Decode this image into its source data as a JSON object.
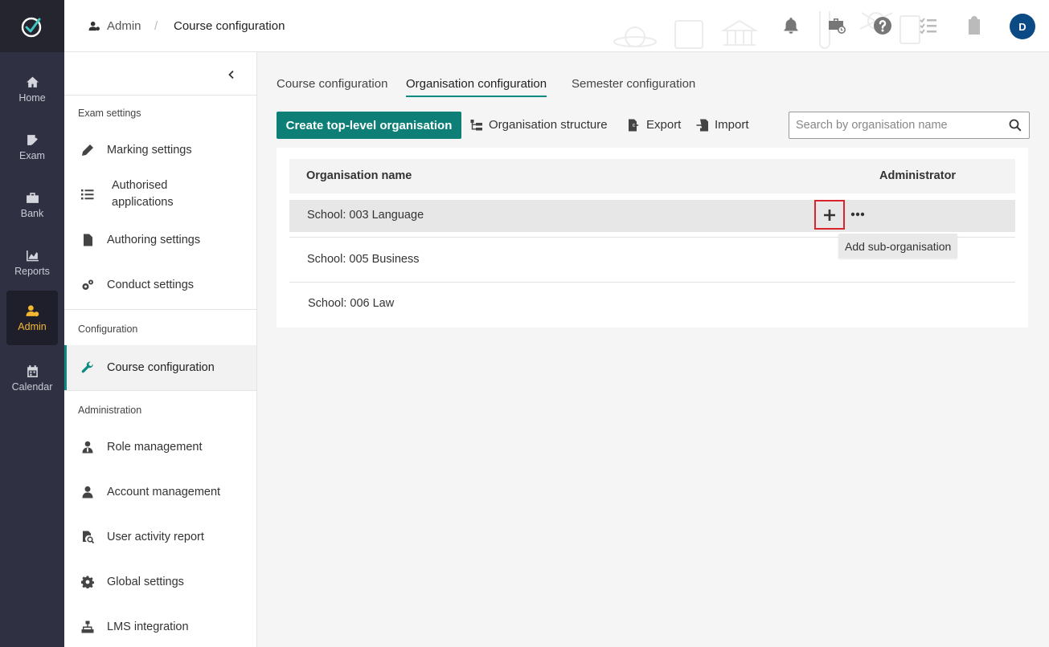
{
  "rail": {
    "items": [
      {
        "label": "Home",
        "icon": "home-icon"
      },
      {
        "label": "Exam",
        "icon": "exam-icon"
      },
      {
        "label": "Bank",
        "icon": "bank-icon"
      },
      {
        "label": "Reports",
        "icon": "reports-icon"
      },
      {
        "label": "Admin",
        "icon": "admin-icon",
        "active": true
      },
      {
        "label": "Calendar",
        "icon": "calendar-icon"
      }
    ],
    "active_color": "#f5b731"
  },
  "header": {
    "breadcrumb_root": "Admin",
    "breadcrumb_sep": "/",
    "breadcrumb_current": "Course configuration",
    "avatar_initial": "D"
  },
  "sidebar": {
    "sections": [
      {
        "label": "Exam settings"
      },
      {
        "label": "Configuration"
      },
      {
        "label": "Administration"
      }
    ],
    "items": [
      {
        "label": "Marking settings",
        "icon": "pencil-icon"
      },
      {
        "label": "Authorised applications",
        "icon": "list-icon"
      },
      {
        "label": "Authoring settings",
        "icon": "document-icon"
      },
      {
        "label": "Conduct settings",
        "icon": "gears-icon"
      },
      {
        "label": "Course configuration",
        "icon": "wrench-icon",
        "active": true
      },
      {
        "label": "Role management",
        "icon": "role-user-icon"
      },
      {
        "label": "Account management",
        "icon": "user-icon"
      },
      {
        "label": "User activity report",
        "icon": "file-search-icon"
      },
      {
        "label": "Global settings",
        "icon": "gear-icon"
      },
      {
        "label": "LMS integration",
        "icon": "sitemap-icon"
      }
    ]
  },
  "tabs": [
    {
      "label": "Course configuration"
    },
    {
      "label": "Organisation configuration",
      "active": true
    },
    {
      "label": "Semester configuration"
    }
  ],
  "toolbar": {
    "create_label": "Create top-level organisation",
    "structure_label": "Organisation structure",
    "export_label": "Export",
    "import_label": "Import",
    "search_placeholder": "Search by organisation name"
  },
  "table": {
    "columns": [
      "Organisation name",
      "Administrator"
    ],
    "rows": [
      {
        "name": "School: 003 Language"
      },
      {
        "name": "School: 005 Business"
      },
      {
        "name": "School: 006 Law"
      }
    ]
  },
  "tooltip": "Add sub-organisation",
  "colors": {
    "accent": "#0e7f77",
    "highlight_border": "#d9232d",
    "avatar": "#0c4a86"
  }
}
